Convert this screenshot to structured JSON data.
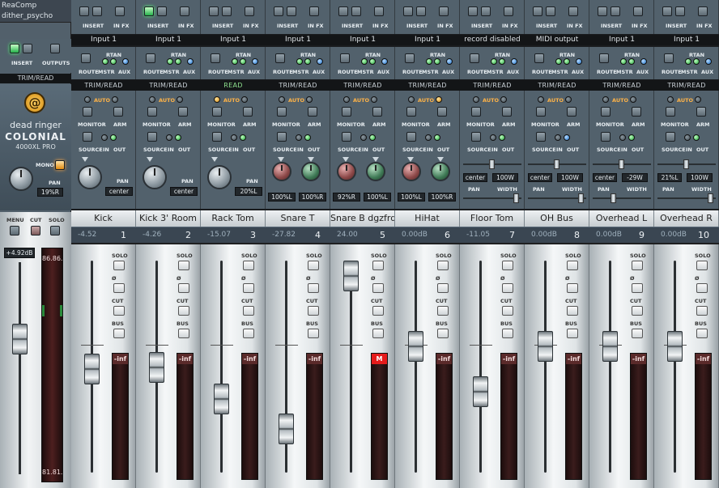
{
  "plugin_list": [
    "ReaComp",
    "dither_psycho"
  ],
  "labels": {
    "insert": "INSERT",
    "in_fx": "IN FX",
    "outputs": "OUTPUTS",
    "route": "ROUTE",
    "rtan": "RTAN",
    "mstr": "MSTR",
    "aux": "AUX",
    "auto": "AUTO",
    "monitor": "MONITOR",
    "arm": "ARM",
    "source": "SOURCE",
    "in": "IN",
    "out": "OUT",
    "pan": "PAN",
    "width": "WIDTH",
    "solo": "SOLO",
    "phase": "Ø",
    "cut": "CUT",
    "bus": "BUS",
    "menu": "MENU",
    "mono": "MONO"
  },
  "master": {
    "mode": "TRIM/READ",
    "brand": "dead ringer",
    "model": "COLONIAL",
    "submodel": "4000XL PRO",
    "pan_value": "19%R",
    "level_display": "+4.92dB",
    "meter_top": "86.86.",
    "meter_bottom": "81.81."
  },
  "channels": [
    {
      "name": "Kick",
      "input": "Input 1",
      "mode": "TRIM/READ",
      "gain": "-4.52",
      "num": "1",
      "pan_type": "single",
      "pan": "center",
      "fader": 0.5,
      "insert_on": false,
      "solo": "off",
      "cut": "off",
      "bus": "off",
      "meter": "-inf"
    },
    {
      "name": "Kick 3' Room",
      "input": "Input 1",
      "mode": "TRIM/READ",
      "gain": "-4.26",
      "num": "2",
      "pan_type": "single",
      "pan": "center",
      "fader": 0.51,
      "insert_on": true,
      "solo": "blue",
      "cut": "off",
      "bus": "off",
      "meter": "-inf"
    },
    {
      "name": "Rack Tom",
      "input": "Input 1",
      "mode": "READ",
      "gain": "-15.07",
      "num": "3",
      "pan_type": "single",
      "pan": "20%L",
      "fader": 0.34,
      "insert_on": false,
      "solo": "off",
      "cut": "off",
      "bus": "off",
      "meter": "-inf"
    },
    {
      "name": "Snare T",
      "input": "Input 1",
      "mode": "TRIM/READ",
      "gain": "-27.82",
      "num": "4",
      "pan_type": "dual",
      "pan_l": "100%L",
      "pan_r": "100%R",
      "fader": 0.18,
      "insert_on": false,
      "solo": "off",
      "cut": "off",
      "bus": "off",
      "meter": "-inf"
    },
    {
      "name": "Snare B dgzfrd",
      "input": "Input 1",
      "mode": "TRIM/READ",
      "gain": "24.00",
      "num": "5",
      "pan_type": "dual",
      "pan_l": "92%R",
      "pan_r": "100%L",
      "fader": 1.0,
      "insert_on": false,
      "solo": "off",
      "cut": "red",
      "bus": "off",
      "meter": "M"
    },
    {
      "name": "HiHat",
      "input": "Input 1",
      "mode": "TRIM/READ",
      "gain": "0.00dB",
      "num": "6",
      "pan_type": "dual",
      "pan_l": "100%L",
      "pan_r": "100%R",
      "fader": 0.62,
      "insert_on": false,
      "solo": "off",
      "cut": "off",
      "bus": "off",
      "meter": "-inf"
    },
    {
      "name": "Floor Tom",
      "input": "record disabled",
      "mode": "TRIM/READ",
      "gain": "-11.05",
      "num": "7",
      "pan_type": "stereo",
      "pan": "center",
      "width": "100W",
      "fader": 0.38,
      "insert_on": false,
      "solo": "off",
      "cut": "off",
      "bus": "off",
      "meter": "-inf"
    },
    {
      "name": "OH Bus",
      "input": "MIDI output",
      "mode": "TRIM/READ",
      "gain": "0.00dB",
      "num": "8",
      "pan_type": "stereo",
      "pan": "center",
      "width": "100W",
      "fader": 0.62,
      "insert_on": false,
      "solo": "off",
      "cut": "off",
      "bus": "green",
      "meter": "-inf"
    },
    {
      "name": "Overhead L",
      "input": "Input 1",
      "mode": "TRIM/READ",
      "gain": "0.00dB",
      "num": "9",
      "pan_type": "stereo",
      "pan": "center",
      "width": "-29W",
      "fader": 0.62,
      "insert_on": false,
      "solo": "orange",
      "cut": "off",
      "bus": "off",
      "meter": "-inf"
    },
    {
      "name": "Overhead R",
      "input": "Input 1",
      "mode": "TRIM/READ",
      "gain": "0.00dB",
      "num": "10",
      "pan_type": "stereo",
      "pan": "21%L",
      "width": "100W",
      "fader": 0.62,
      "insert_on": false,
      "solo": "green",
      "cut": "off",
      "bus": "green",
      "meter": "-inf"
    }
  ]
}
